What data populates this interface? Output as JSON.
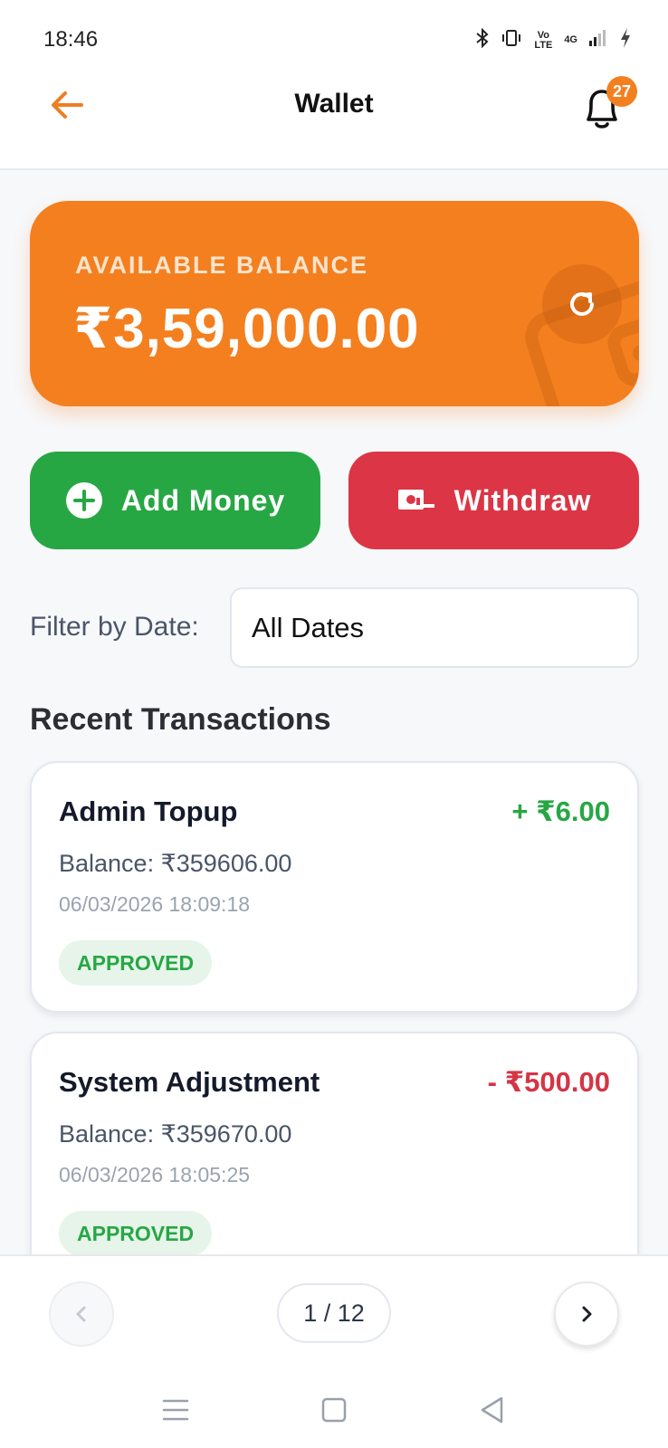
{
  "status_bar": {
    "time": "18:46",
    "network_label": "4G",
    "volte_label": "Vo LTE"
  },
  "header": {
    "title": "Wallet",
    "notification_count": "27",
    "icons": [
      "arrow-left-icon",
      "bell-icon"
    ]
  },
  "balance_card": {
    "label": "AVAILABLE BALANCE",
    "amount": "₹3,59,000.00",
    "icons": [
      "refresh-icon",
      "wallet-icon"
    ]
  },
  "actions": {
    "add_money_label": "Add Money",
    "withdraw_label": "Withdraw"
  },
  "filter": {
    "label": "Filter by Date:",
    "selected": "All Dates"
  },
  "transactions": {
    "section_title": "Recent Transactions",
    "items": [
      {
        "title": "Admin Topup",
        "amount": "+ ₹6.00",
        "type": "credit",
        "balance": "Balance: ₹359606.00",
        "date": "06/03/2026 18:09:18",
        "status": "APPROVED"
      },
      {
        "title": "System Adjustment",
        "amount": "- ₹500.00",
        "type": "debit",
        "balance": "Balance: ₹359670.00",
        "date": "06/03/2026 18:05:25",
        "status": "APPROVED"
      }
    ]
  },
  "pagination": {
    "indicator": "1 / 12"
  },
  "colors": {
    "accent": "#f47f1f",
    "success": "#27a744",
    "danger": "#dc3545"
  }
}
